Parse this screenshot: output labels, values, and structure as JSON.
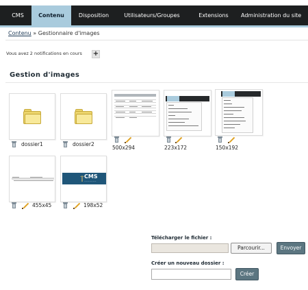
{
  "nav": {
    "tabs": [
      {
        "label": "CMS",
        "active": false
      },
      {
        "label": "Contenu",
        "active": true
      },
      {
        "label": "Disposition",
        "active": false
      },
      {
        "label": "Utilisateurs/Groupes",
        "active": false
      },
      {
        "label": "Extensions",
        "active": false
      },
      {
        "label": "Administration du site",
        "active": false
      }
    ]
  },
  "breadcrumb": {
    "link": "Contenu",
    "separator": "»",
    "current": "Gestionnaire d'images"
  },
  "notifications": {
    "text": "Vous avez 2 notifications en cours",
    "add_label": "+"
  },
  "section": {
    "title": "Gestion d'images"
  },
  "folders": [
    {
      "name": "dossier1"
    },
    {
      "name": "dossier2"
    }
  ],
  "images": [
    {
      "dimensions": "500x294"
    },
    {
      "dimensions": "223x172"
    },
    {
      "dimensions": "150x192"
    },
    {
      "dimensions": "455x45"
    },
    {
      "dimensions": "198x52"
    }
  ],
  "thumb_logo": {
    "text": "CMS"
  },
  "upload": {
    "label": "Télécharger le fichier :",
    "browse_label": "Parcourir...",
    "send_label": "Envoyer"
  },
  "new_folder": {
    "label": "Créer un nouveau dossier :",
    "create_label": "Créer"
  },
  "colors": {
    "nav_bg": "#1d1f20",
    "accent": "#a9cbdd",
    "button_dark": "#5c7681",
    "folder": "#ecd56d"
  }
}
